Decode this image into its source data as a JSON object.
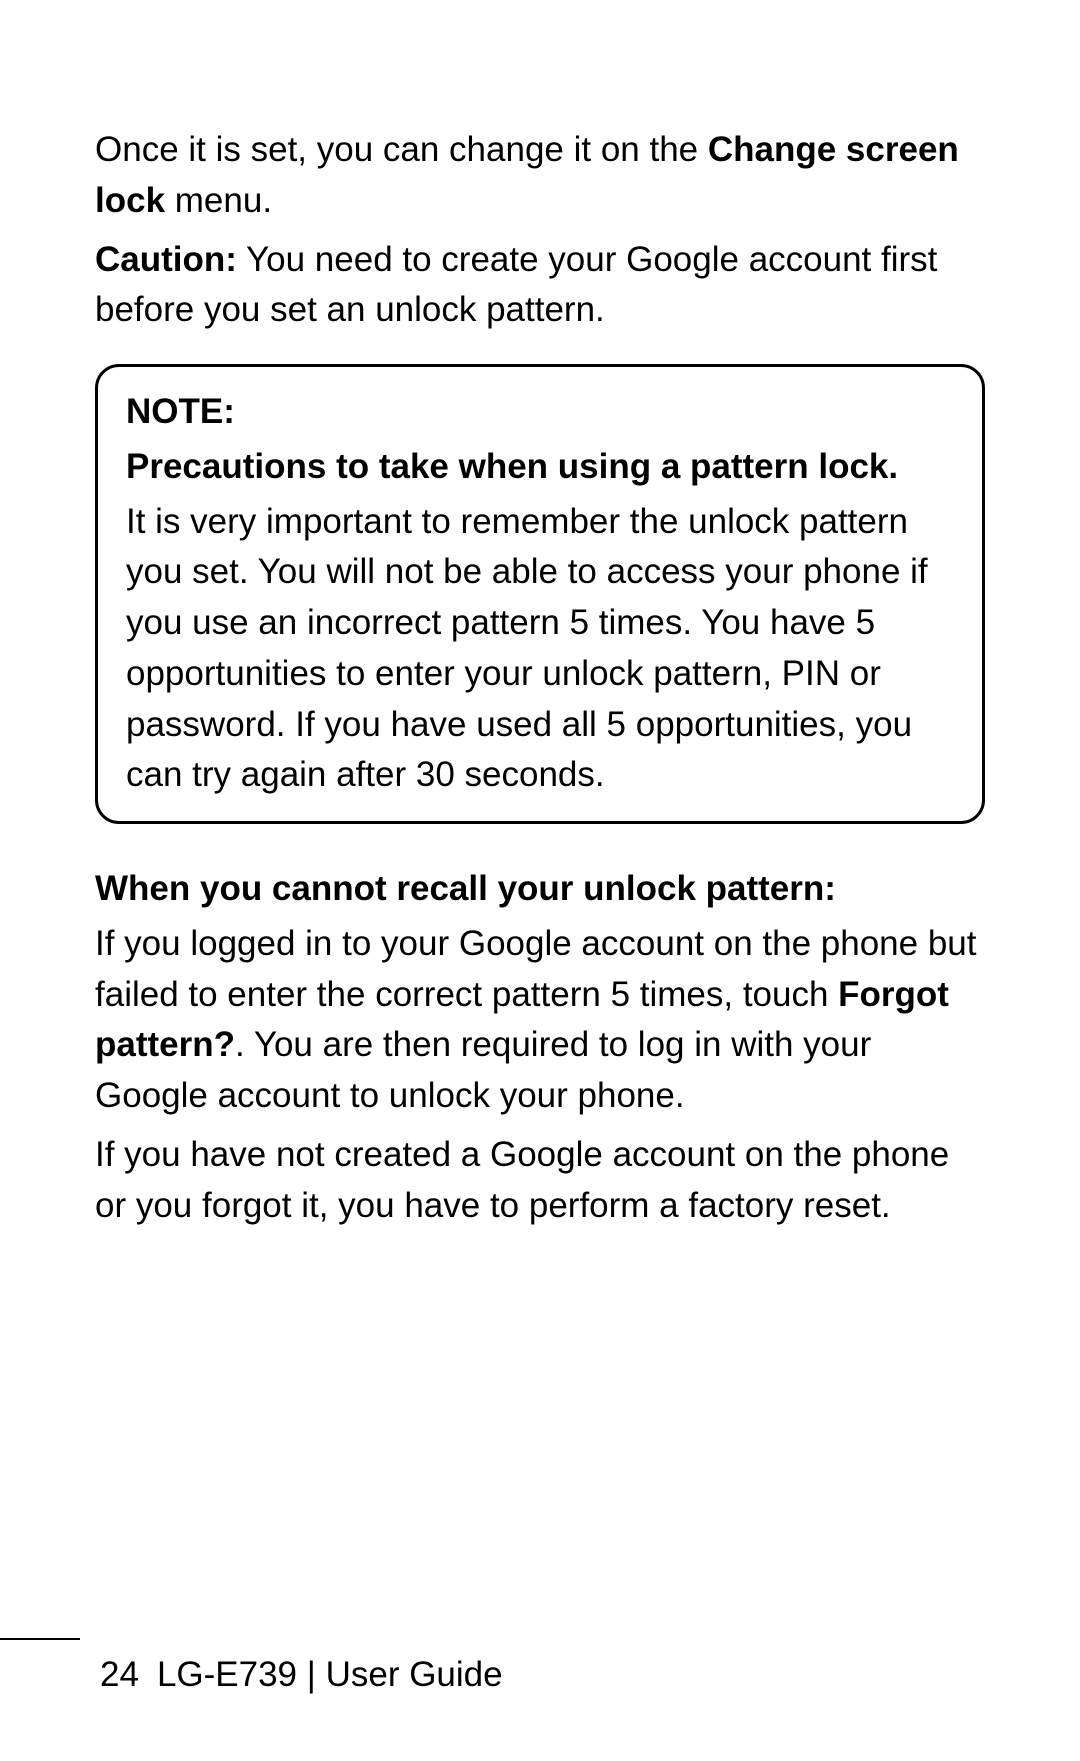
{
  "intro": {
    "before": "Once it is set, you can change it on the ",
    "bold": "Change screen lock",
    "after": " menu."
  },
  "caution": {
    "label": "Caution:",
    "text": " You need to create your Google account first before you set an unlock pattern."
  },
  "note": {
    "title": "NOTE:",
    "subtitle": "Precautions to take when using a pattern lock.",
    "body": "It is very important to remember the unlock pattern you set. You will not be able to access your phone if you use an incorrect pattern 5 times. You have 5 opportunities to enter your unlock pattern, PIN or password. If you have used all 5 opportunities, you can try again after 30 seconds."
  },
  "recall": {
    "heading": "When you cannot recall your unlock pattern:",
    "para1_before": "If you logged in to your Google account on the phone but failed to enter the correct pattern 5 times, touch ",
    "para1_bold": "Forgot pattern?",
    "para1_after": ". You are then required to log in with your Google account to unlock your phone.",
    "para2": "If you have not created a Google account on the phone or you forgot it, you have to perform a factory reset."
  },
  "footer": {
    "page": "24",
    "model": "LG-E739",
    "separator": "  |  ",
    "guide": "User Guide"
  }
}
